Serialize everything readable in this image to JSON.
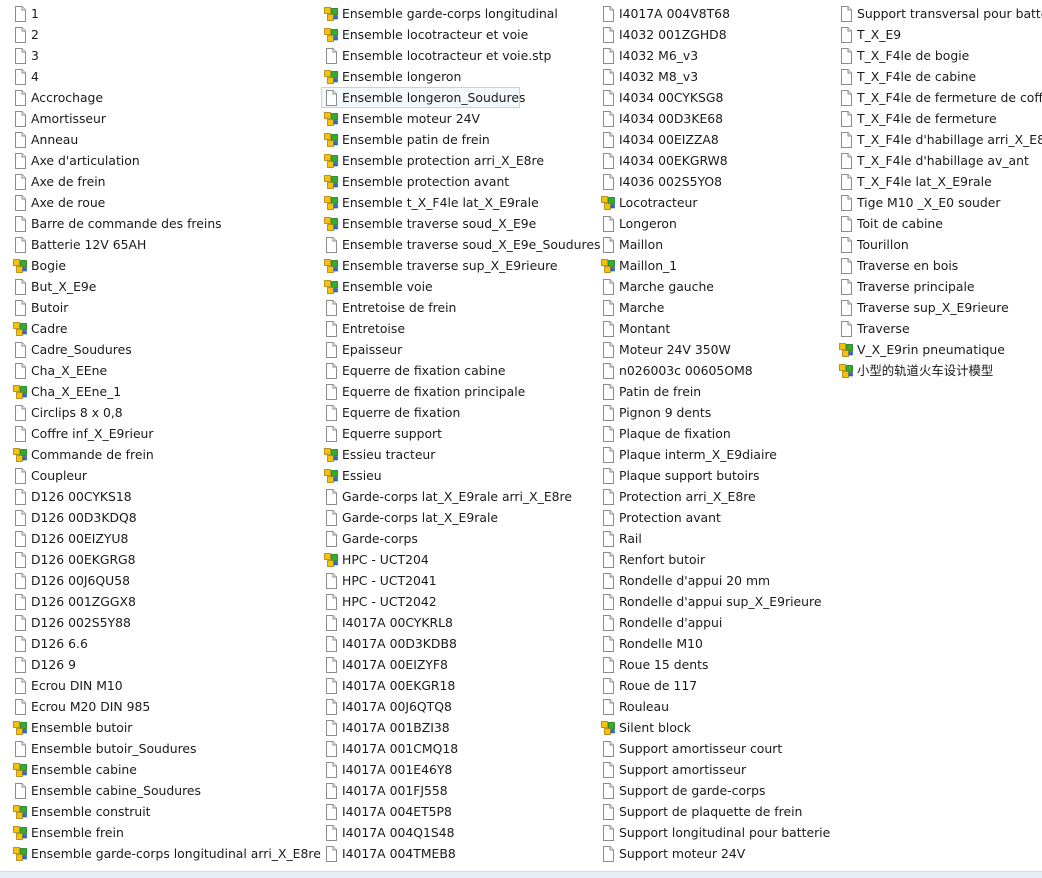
{
  "file_list": {
    "columns": [
      {
        "items": [
          {
            "name": "1",
            "icon": "document-icon"
          },
          {
            "name": "2",
            "icon": "document-icon"
          },
          {
            "name": "3",
            "icon": "document-icon"
          },
          {
            "name": "4",
            "icon": "document-icon"
          },
          {
            "name": "Accrochage",
            "icon": "document-icon"
          },
          {
            "name": "Amortisseur",
            "icon": "document-icon"
          },
          {
            "name": "Anneau",
            "icon": "document-icon"
          },
          {
            "name": "Axe d'articulation",
            "icon": "document-icon"
          },
          {
            "name": "Axe de frein",
            "icon": "document-icon"
          },
          {
            "name": "Axe de roue",
            "icon": "document-icon"
          },
          {
            "name": "Barre de commande des freins",
            "icon": "document-icon"
          },
          {
            "name": "Batterie 12V 65AH",
            "icon": "document-icon"
          },
          {
            "name": "Bogie",
            "icon": "assembly-icon"
          },
          {
            "name": "But_X_E9e",
            "icon": "document-icon"
          },
          {
            "name": "Butoir",
            "icon": "document-icon"
          },
          {
            "name": "Cadre",
            "icon": "assembly-icon"
          },
          {
            "name": "Cadre_Soudures",
            "icon": "document-icon"
          },
          {
            "name": "Cha_X_EEne",
            "icon": "document-icon"
          },
          {
            "name": "Cha_X_EEne_1",
            "icon": "assembly-icon"
          },
          {
            "name": "Circlips 8 x 0,8",
            "icon": "document-icon"
          },
          {
            "name": "Coffre inf_X_E9rieur",
            "icon": "document-icon"
          },
          {
            "name": "Commande de frein",
            "icon": "assembly-icon"
          },
          {
            "name": "Coupleur",
            "icon": "document-icon"
          },
          {
            "name": "D126 00CYKS18",
            "icon": "document-icon"
          },
          {
            "name": "D126 00D3KDQ8",
            "icon": "document-icon"
          },
          {
            "name": "D126 00EIZYU8",
            "icon": "document-icon"
          },
          {
            "name": "D126 00EKGRG8",
            "icon": "document-icon"
          },
          {
            "name": "D126 00J6QU58",
            "icon": "document-icon"
          },
          {
            "name": "D126 001ZGGX8",
            "icon": "document-icon"
          },
          {
            "name": "D126 002S5Y88",
            "icon": "document-icon"
          },
          {
            "name": "D126 6.6",
            "icon": "document-icon"
          },
          {
            "name": "D126 9",
            "icon": "document-icon"
          },
          {
            "name": "Ecrou DIN M10",
            "icon": "document-icon"
          },
          {
            "name": "Ecrou M20 DIN 985",
            "icon": "document-icon"
          },
          {
            "name": "Ensemble butoir",
            "icon": "assembly-icon"
          },
          {
            "name": "Ensemble butoir_Soudures",
            "icon": "document-icon"
          },
          {
            "name": "Ensemble cabine",
            "icon": "assembly-icon"
          },
          {
            "name": "Ensemble cabine_Soudures",
            "icon": "document-icon"
          },
          {
            "name": "Ensemble construit",
            "icon": "assembly-icon"
          },
          {
            "name": "Ensemble frein",
            "icon": "assembly-icon"
          },
          {
            "name": "Ensemble garde-corps longitudinal arri_X_E8re",
            "icon": "assembly-icon"
          }
        ]
      },
      {
        "items": [
          {
            "name": "Ensemble garde-corps longitudinal",
            "icon": "assembly-icon"
          },
          {
            "name": "Ensemble locotracteur et voie",
            "icon": "assembly-icon"
          },
          {
            "name": "Ensemble locotracteur et voie.stp",
            "icon": "document-icon"
          },
          {
            "name": "Ensemble longeron",
            "icon": "assembly-icon"
          },
          {
            "name": "Ensemble longeron_Soudures",
            "icon": "document-icon",
            "selected": true
          },
          {
            "name": "Ensemble moteur 24V",
            "icon": "assembly-icon"
          },
          {
            "name": "Ensemble patin de frein",
            "icon": "assembly-icon"
          },
          {
            "name": "Ensemble protection arri_X_E8re",
            "icon": "assembly-icon"
          },
          {
            "name": "Ensemble protection avant",
            "icon": "assembly-icon"
          },
          {
            "name": "Ensemble t_X_F4le lat_X_E9rale",
            "icon": "assembly-icon"
          },
          {
            "name": "Ensemble traverse soud_X_E9e",
            "icon": "assembly-icon"
          },
          {
            "name": "Ensemble traverse soud_X_E9e_Soudures",
            "icon": "document-icon"
          },
          {
            "name": "Ensemble traverse sup_X_E9rieure",
            "icon": "assembly-icon"
          },
          {
            "name": "Ensemble voie",
            "icon": "assembly-icon"
          },
          {
            "name": "Entretoise de frein",
            "icon": "document-icon"
          },
          {
            "name": "Entretoise",
            "icon": "document-icon"
          },
          {
            "name": "Epaisseur",
            "icon": "document-icon"
          },
          {
            "name": "Equerre de fixation cabine",
            "icon": "document-icon"
          },
          {
            "name": "Equerre de fixation principale",
            "icon": "document-icon"
          },
          {
            "name": "Equerre de fixation",
            "icon": "document-icon"
          },
          {
            "name": "Equerre support",
            "icon": "document-icon"
          },
          {
            "name": "Essieu tracteur",
            "icon": "assembly-icon"
          },
          {
            "name": "Essieu",
            "icon": "assembly-icon"
          },
          {
            "name": "Garde-corps lat_X_E9rale arri_X_E8re",
            "icon": "document-icon"
          },
          {
            "name": "Garde-corps lat_X_E9rale",
            "icon": "document-icon"
          },
          {
            "name": "Garde-corps",
            "icon": "document-icon"
          },
          {
            "name": "HPC - UCT204",
            "icon": "assembly-icon"
          },
          {
            "name": "HPC - UCT2041",
            "icon": "document-icon"
          },
          {
            "name": "HPC - UCT2042",
            "icon": "document-icon"
          },
          {
            "name": "I4017A 00CYKRL8",
            "icon": "document-icon"
          },
          {
            "name": "I4017A 00D3KDB8",
            "icon": "document-icon"
          },
          {
            "name": "I4017A 00EIZYF8",
            "icon": "document-icon"
          },
          {
            "name": "I4017A 00EKGR18",
            "icon": "document-icon"
          },
          {
            "name": "I4017A 00J6QTQ8",
            "icon": "document-icon"
          },
          {
            "name": "I4017A 001BZI38",
            "icon": "document-icon"
          },
          {
            "name": "I4017A 001CMQ18",
            "icon": "document-icon"
          },
          {
            "name": "I4017A 001E46Y8",
            "icon": "document-icon"
          },
          {
            "name": "I4017A 001FJ558",
            "icon": "document-icon"
          },
          {
            "name": "I4017A 004ET5P8",
            "icon": "document-icon"
          },
          {
            "name": "I4017A 004Q1S48",
            "icon": "document-icon"
          },
          {
            "name": "I4017A 004TMEB8",
            "icon": "document-icon"
          }
        ]
      },
      {
        "items": [
          {
            "name": "I4017A 004V8T68",
            "icon": "document-icon"
          },
          {
            "name": "I4032 001ZGHD8",
            "icon": "document-icon"
          },
          {
            "name": "I4032 M6_v3",
            "icon": "document-icon"
          },
          {
            "name": "I4032 M8_v3",
            "icon": "document-icon"
          },
          {
            "name": "I4034 00CYKSG8",
            "icon": "document-icon"
          },
          {
            "name": "I4034 00D3KE68",
            "icon": "document-icon"
          },
          {
            "name": "I4034 00EIZZA8",
            "icon": "document-icon"
          },
          {
            "name": "I4034 00EKGRW8",
            "icon": "document-icon"
          },
          {
            "name": "I4036 002S5YO8",
            "icon": "document-icon"
          },
          {
            "name": "Locotracteur",
            "icon": "assembly-icon"
          },
          {
            "name": "Longeron",
            "icon": "document-icon"
          },
          {
            "name": "Maillon",
            "icon": "document-icon"
          },
          {
            "name": "Maillon_1",
            "icon": "assembly-icon"
          },
          {
            "name": "Marche gauche",
            "icon": "document-icon"
          },
          {
            "name": "Marche",
            "icon": "document-icon"
          },
          {
            "name": "Montant",
            "icon": "document-icon"
          },
          {
            "name": "Moteur 24V 350W",
            "icon": "document-icon"
          },
          {
            "name": "n026003c 00605OM8",
            "icon": "document-icon"
          },
          {
            "name": "Patin de frein",
            "icon": "document-icon"
          },
          {
            "name": "Pignon 9 dents",
            "icon": "document-icon"
          },
          {
            "name": "Plaque de fixation",
            "icon": "document-icon"
          },
          {
            "name": "Plaque interm_X_E9diaire",
            "icon": "document-icon"
          },
          {
            "name": "Plaque support butoirs",
            "icon": "document-icon"
          },
          {
            "name": "Protection arri_X_E8re",
            "icon": "document-icon"
          },
          {
            "name": "Protection avant",
            "icon": "document-icon"
          },
          {
            "name": "Rail",
            "icon": "document-icon"
          },
          {
            "name": "Renfort butoir",
            "icon": "document-icon"
          },
          {
            "name": "Rondelle d'appui 20 mm",
            "icon": "document-icon"
          },
          {
            "name": "Rondelle d'appui sup_X_E9rieure",
            "icon": "document-icon"
          },
          {
            "name": "Rondelle d'appui",
            "icon": "document-icon"
          },
          {
            "name": "Rondelle M10",
            "icon": "document-icon"
          },
          {
            "name": "Roue 15 dents",
            "icon": "document-icon"
          },
          {
            "name": "Roue de 117",
            "icon": "document-icon"
          },
          {
            "name": "Rouleau",
            "icon": "document-icon"
          },
          {
            "name": "Silent block",
            "icon": "assembly-icon"
          },
          {
            "name": "Support amortisseur court",
            "icon": "document-icon"
          },
          {
            "name": "Support amortisseur",
            "icon": "document-icon"
          },
          {
            "name": "Support de garde-corps",
            "icon": "document-icon"
          },
          {
            "name": "Support de plaquette de frein",
            "icon": "document-icon"
          },
          {
            "name": "Support longitudinal pour batterie",
            "icon": "document-icon"
          },
          {
            "name": "Support moteur 24V",
            "icon": "document-icon"
          }
        ]
      },
      {
        "items": [
          {
            "name": "Support transversal pour batterie",
            "icon": "document-icon"
          },
          {
            "name": "T_X_E9",
            "icon": "document-icon"
          },
          {
            "name": "T_X_F4le de bogie",
            "icon": "document-icon"
          },
          {
            "name": "T_X_F4le de cabine",
            "icon": "document-icon"
          },
          {
            "name": "T_X_F4le de fermeture de coffre",
            "icon": "document-icon"
          },
          {
            "name": "T_X_F4le de fermeture",
            "icon": "document-icon"
          },
          {
            "name": "T_X_F4le d'habillage arri_X_E8re",
            "icon": "document-icon"
          },
          {
            "name": "T_X_F4le d'habillage av_ant",
            "icon": "document-icon"
          },
          {
            "name": "T_X_F4le lat_X_E9rale",
            "icon": "document-icon"
          },
          {
            "name": "Tige M10 _X_E0 souder",
            "icon": "document-icon"
          },
          {
            "name": "Toit de cabine",
            "icon": "document-icon"
          },
          {
            "name": "Tourillon",
            "icon": "document-icon"
          },
          {
            "name": "Traverse en bois",
            "icon": "document-icon"
          },
          {
            "name": "Traverse principale",
            "icon": "document-icon"
          },
          {
            "name": "Traverse sup_X_E9rieure",
            "icon": "document-icon"
          },
          {
            "name": "Traverse",
            "icon": "document-icon"
          },
          {
            "name": "V_X_E9rin pneumatique",
            "icon": "assembly-icon"
          },
          {
            "name": "小型的轨道火车设计模型",
            "icon": "assembly-icon"
          }
        ]
      }
    ]
  },
  "colors": {
    "selection_background": "#f3f8fd",
    "selection_border": "#bcd6ee",
    "assembly_yellow": "#f4c20d",
    "assembly_green": "#2fae2f",
    "assembly_blue": "#2f6fd6"
  }
}
